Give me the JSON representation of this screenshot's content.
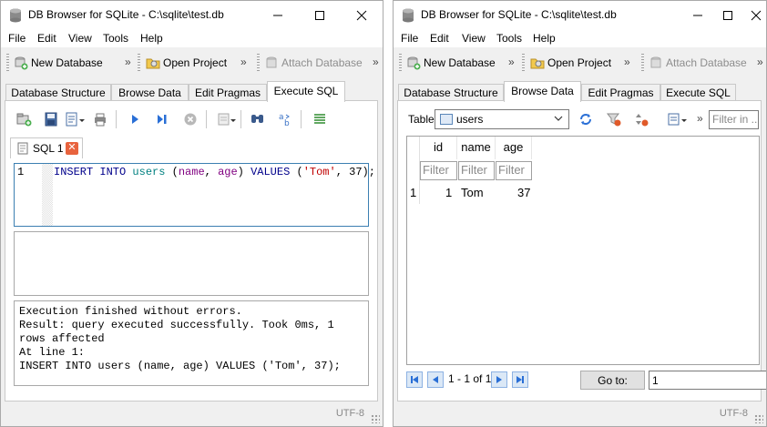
{
  "colors": {
    "keyword": "#00008b",
    "table_name": "#008080",
    "column_name": "#800080",
    "string": "#c00000",
    "active_border": "#3c7fb1"
  },
  "left_window": {
    "title": "DB Browser for SQLite - C:\\sqlite\\test.db",
    "menu": [
      "File",
      "Edit",
      "View",
      "Tools",
      "Help"
    ],
    "toolbar": {
      "new_database": "New Database",
      "open_project": "Open Project",
      "attach_database": "Attach Database",
      "more": "»"
    },
    "tabs": [
      "Database Structure",
      "Browse Data",
      "Edit Pragmas",
      "Execute SQL"
    ],
    "active_tab": "Execute SQL",
    "sql_tab": {
      "label": "SQL 1",
      "close": "✕"
    },
    "editor": {
      "line_number": "1",
      "tokens": {
        "kw1": "INSERT INTO",
        "table": "users",
        "open": " (",
        "col1": "name",
        "comma": ", ",
        "col2": "age",
        "close": ") ",
        "kw2": "VALUES",
        "open2": " (",
        "str": "'Tom'",
        "rest": ", 37);"
      }
    },
    "messages": [
      "Execution finished without errors.",
      "Result: query executed successfully. Took 0ms, 1 rows affected",
      "At line 1:",
      "INSERT INTO users (name, age) VALUES ('Tom', 37);"
    ],
    "encoding": "UTF-8"
  },
  "right_window": {
    "title": "DB Browser for SQLite - C:\\sqlite\\test.db",
    "menu": [
      "File",
      "Edit",
      "View",
      "Tools",
      "Help"
    ],
    "toolbar": {
      "new_database": "New Database",
      "open_project": "Open Project",
      "attach_database": "Attach Database",
      "more": "»"
    },
    "tabs": [
      "Database Structure",
      "Browse Data",
      "Edit Pragmas",
      "Execute SQL"
    ],
    "active_tab": "Browse Data",
    "table_label": "Table:",
    "table_selected": "users",
    "more": "»",
    "filter_placeholder": "Filter in ...",
    "grid": {
      "columns": [
        "id",
        "name",
        "age"
      ],
      "filter_placeholder": "Filter",
      "rows": [
        {
          "rownum": "1",
          "id": "1",
          "name": "Tom",
          "age": "37"
        }
      ]
    },
    "pager": {
      "range": "1 - 1 of 1",
      "goto_label": "Go to:",
      "goto_value": "1"
    },
    "encoding": "UTF-8"
  }
}
